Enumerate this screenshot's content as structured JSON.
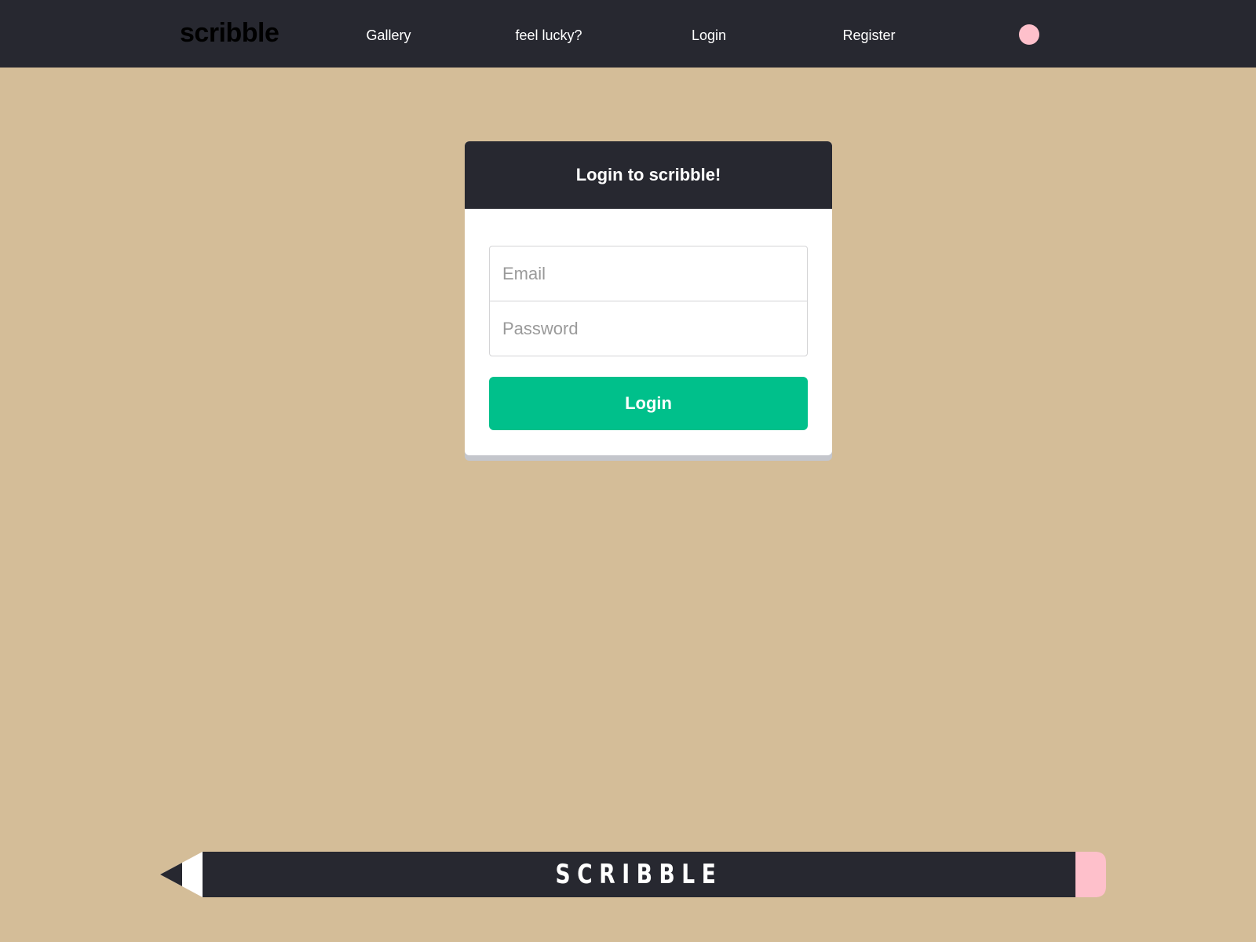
{
  "navbar": {
    "brand": "scribble",
    "links": [
      "Gallery",
      "feel lucky?",
      "Login",
      "Register"
    ]
  },
  "login_card": {
    "title": "Login to scribble!",
    "email_placeholder": "Email",
    "password_placeholder": "Password",
    "submit_label": "Login"
  },
  "footer": {
    "pencil_label": "SCRIBBLE"
  },
  "colors": {
    "background": "#d4bd98",
    "navbar": "#272830",
    "accent_green": "#00c08b",
    "pink": "#fec0cb"
  }
}
